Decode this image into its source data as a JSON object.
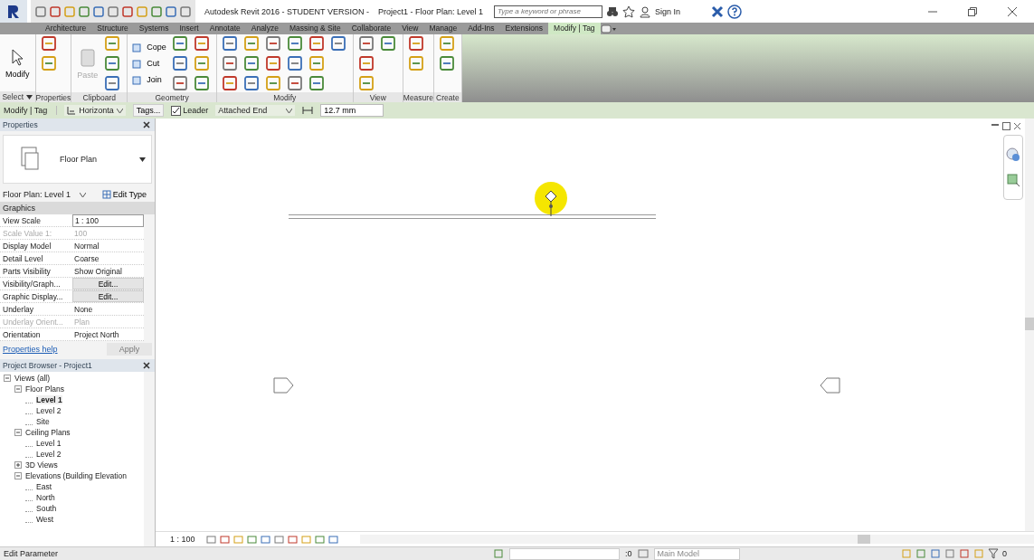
{
  "title_bar": {
    "title": "Autodesk Revit 2016 - STUDENT VERSION -    Project1 - Floor Plan: Level 1",
    "search_placeholder": "Type a keyword or phrase",
    "sign_in": "Sign In"
  },
  "ribbon_tabs": [
    {
      "label": "Architecture",
      "selected": false
    },
    {
      "label": "Structure",
      "selected": false
    },
    {
      "label": "Systems",
      "selected": false
    },
    {
      "label": "Insert",
      "selected": false
    },
    {
      "label": "Annotate",
      "selected": false
    },
    {
      "label": "Analyze",
      "selected": false
    },
    {
      "label": "Massing & Site",
      "selected": false
    },
    {
      "label": "Collaborate",
      "selected": false
    },
    {
      "label": "View",
      "selected": false
    },
    {
      "label": "Manage",
      "selected": false
    },
    {
      "label": "Add-Ins",
      "selected": false
    },
    {
      "label": "Extensions",
      "selected": false
    },
    {
      "label": "Modify | Tag",
      "selected": true
    }
  ],
  "ribbon_panels": [
    {
      "label": "Select",
      "tools": [
        {
          "label": "Modify",
          "kind": "big"
        }
      ]
    },
    {
      "label": "Properties"
    },
    {
      "label": "Clipboard",
      "tools": [
        {
          "label": "Paste",
          "kind": "big_disabled"
        }
      ]
    },
    {
      "label": "Geometry",
      "tools": [
        {
          "label": "Cope",
          "kind": "small"
        },
        {
          "label": "Cut",
          "kind": "small"
        },
        {
          "label": "Join",
          "kind": "small"
        }
      ]
    },
    {
      "label": "Modify"
    },
    {
      "label": "View"
    },
    {
      "label": "Measure"
    },
    {
      "label": "Create"
    }
  ],
  "options_bar": {
    "context": "Modify | Tag",
    "orientation": "Horizonta",
    "tags_button": "Tags...",
    "leader": {
      "label": "Leader",
      "checked": true
    },
    "leader_end": "Attached End",
    "length": "12.7 mm"
  },
  "properties": {
    "title": "Properties",
    "type_name": "Floor Plan",
    "instance": "Floor Plan: Level 1",
    "edit_type": "Edit Type",
    "group": "Graphics",
    "rows": [
      {
        "name": "View Scale",
        "value": "1 : 100",
        "kind": "field",
        "disabled": false
      },
      {
        "name": "Scale Value    1:",
        "value": "100",
        "kind": "text",
        "disabled": true
      },
      {
        "name": "Display Model",
        "value": "Normal",
        "kind": "text",
        "disabled": false
      },
      {
        "name": "Detail Level",
        "value": "Coarse",
        "kind": "text",
        "disabled": false
      },
      {
        "name": "Parts Visibility",
        "value": "Show Original",
        "kind": "text",
        "disabled": false
      },
      {
        "name": "Visibility/Graph...",
        "value": "Edit...",
        "kind": "button",
        "disabled": false
      },
      {
        "name": "Graphic Display...",
        "value": "Edit...",
        "kind": "button",
        "disabled": false
      },
      {
        "name": "Underlay",
        "value": "None",
        "kind": "text",
        "disabled": false
      },
      {
        "name": "Underlay Orient...",
        "value": "Plan",
        "kind": "text",
        "disabled": true
      },
      {
        "name": "Orientation",
        "value": "Project North",
        "kind": "text",
        "disabled": false
      }
    ],
    "help": "Properties help",
    "apply": "Apply"
  },
  "browser": {
    "title": "Project Browser - Project1",
    "tree": [
      {
        "label": "Views (all)",
        "expanded": true,
        "selected": false,
        "children": [
          {
            "label": "Floor Plans",
            "expanded": true,
            "selected": false,
            "children": [
              {
                "label": "Level 1",
                "selected": true
              },
              {
                "label": "Level 2",
                "selected": false
              },
              {
                "label": "Site",
                "selected": false
              }
            ]
          },
          {
            "label": "Ceiling Plans",
            "expanded": true,
            "selected": false,
            "children": [
              {
                "label": "Level 1",
                "selected": false
              },
              {
                "label": "Level 2",
                "selected": false
              }
            ]
          },
          {
            "label": "3D Views",
            "expanded": false,
            "selected": false
          },
          {
            "label": "Elevations (Building Elevation",
            "expanded": true,
            "selected": false,
            "children": [
              {
                "label": "East",
                "selected": false
              },
              {
                "label": "North",
                "selected": false
              },
              {
                "label": "South",
                "selected": false
              },
              {
                "label": "West",
                "selected": false
              }
            ]
          }
        ]
      }
    ]
  },
  "view_bar": {
    "scale": "1 : 100"
  },
  "status_bar": {
    "message": "Edit Parameter",
    "pick_count": ":0",
    "model": "Main Model",
    "filter_count": "0"
  }
}
